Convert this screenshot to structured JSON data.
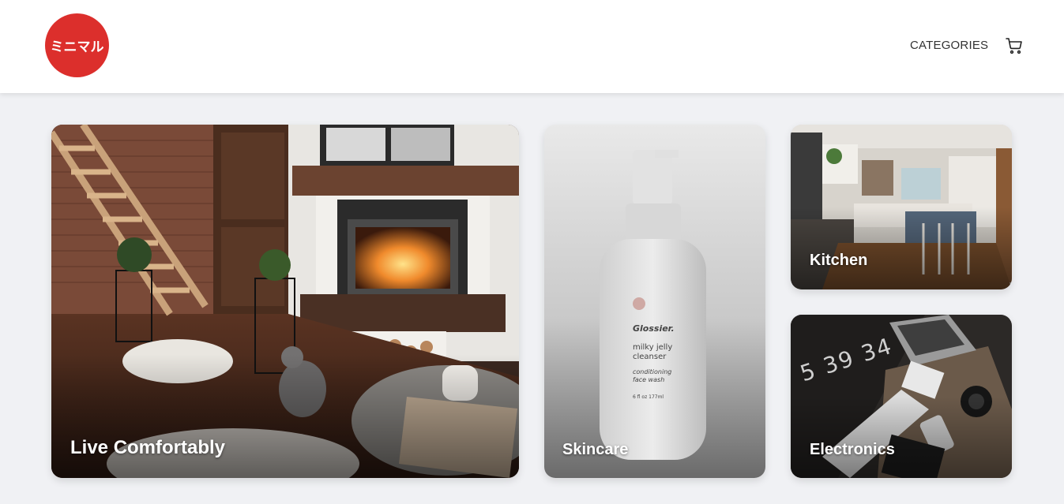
{
  "header": {
    "logo_text": "ミニマル",
    "logo_color": "#dc2f2c",
    "nav_categories": "CATEGORIES",
    "cart_icon": "shopping-cart-icon"
  },
  "cards": {
    "live": {
      "label": "Live Comfortably"
    },
    "skincare": {
      "label": "Skincare",
      "bottle_brand": "Glossier.",
      "bottle_line1": "milky jelly",
      "bottle_line2": "cleanser",
      "bottle_line3": "conditioning",
      "bottle_line4": "face wash",
      "bottle_size": "6 fl oz  177ml"
    },
    "kitchen": {
      "label": "Kitchen"
    },
    "electronics": {
      "label": "Electronics",
      "clock_text": "5 39 34"
    }
  }
}
